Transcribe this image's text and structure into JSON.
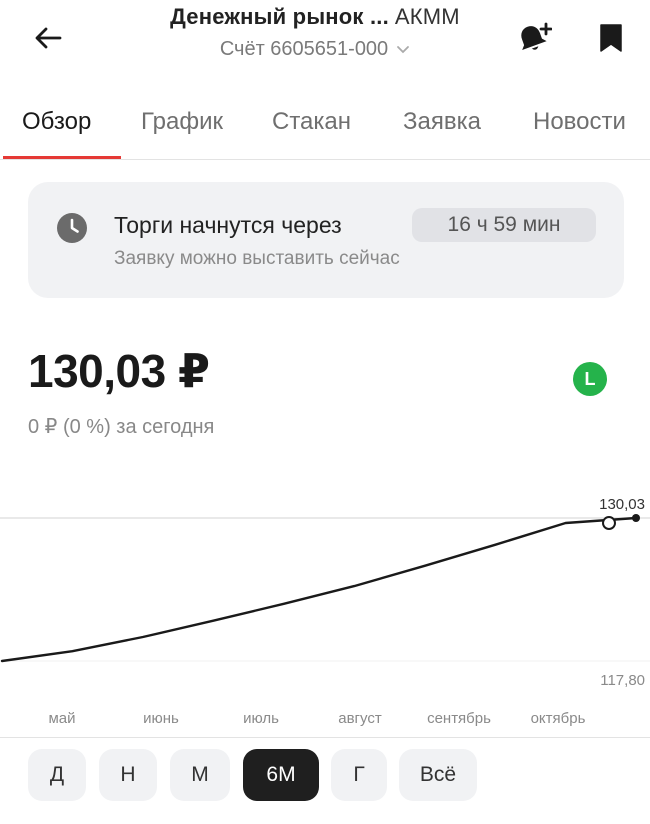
{
  "header": {
    "title": "Денежный рынок ...",
    "ticker": "АКММ",
    "account": "Счёт 6605651-000"
  },
  "tabs": [
    {
      "label": "Обзор",
      "active": true
    },
    {
      "label": "График",
      "active": false
    },
    {
      "label": "Стакан",
      "active": false
    },
    {
      "label": "Заявка",
      "active": false
    },
    {
      "label": "Новости",
      "active": false
    }
  ],
  "notice": {
    "title": "Торги начнутся через",
    "timer": "16 ч 59 мин",
    "subtitle": "Заявку можно выставить сейчас"
  },
  "quote": {
    "price": "130,03 ₽",
    "change": "0 ₽ (0 %) за сегодня",
    "badge": "L",
    "badge_color": "#25b34b"
  },
  "chart_data": {
    "type": "line",
    "x": [
      "май",
      "июнь",
      "июль",
      "август",
      "сентябрь",
      "октябрь"
    ],
    "series": [
      {
        "values": [
          117.8,
          118.64,
          119.85,
          121.25,
          122.69,
          124.21,
          125.94,
          127.74,
          129.6,
          130.03
        ]
      }
    ],
    "ylim": [
      117.8,
      130.03
    ],
    "max_label": "130,03",
    "min_label": "117,80",
    "line_color": "#1a1a1a"
  },
  "periods": [
    {
      "label": "Д",
      "active": false
    },
    {
      "label": "Н",
      "active": false
    },
    {
      "label": "М",
      "active": false
    },
    {
      "label": "6М",
      "active": true
    },
    {
      "label": "Г",
      "active": false
    },
    {
      "label": "Всё",
      "active": false
    }
  ]
}
